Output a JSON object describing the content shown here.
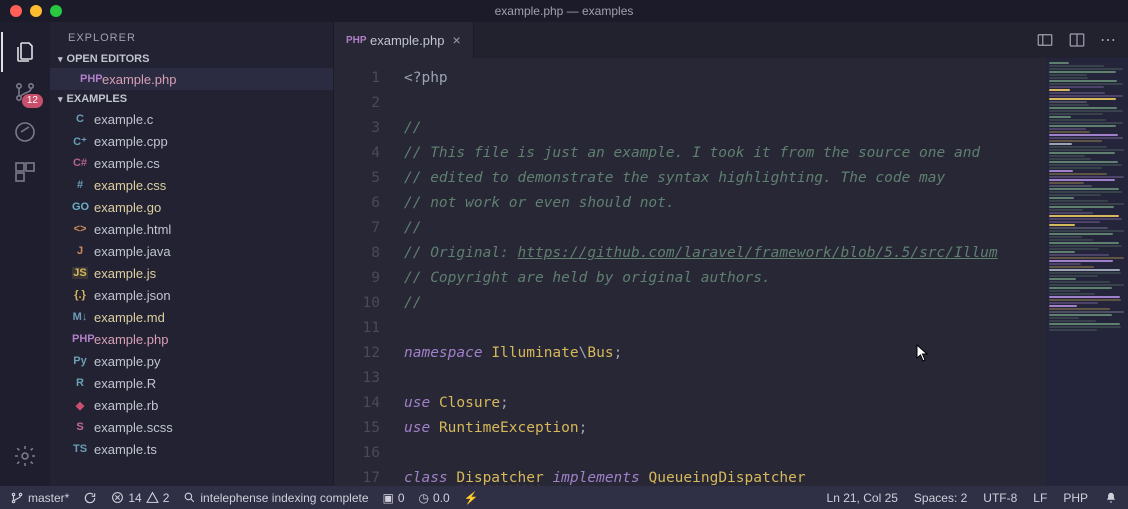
{
  "window": {
    "title": "example.php — examples"
  },
  "activity_bar": {
    "scm_badge": "12"
  },
  "sidebar": {
    "title": "EXPLORER",
    "sections": {
      "open_editors": "OPEN EDITORS",
      "folder": "EXAMPLES"
    },
    "open_editor_item": {
      "name": "example.php",
      "icon": "PHP"
    },
    "files": [
      {
        "name": "example.c",
        "icon": "C",
        "iconClass": "icon-c"
      },
      {
        "name": "example.cpp",
        "icon": "C⁺",
        "iconClass": "icon-cpp"
      },
      {
        "name": "example.cs",
        "icon": "C#",
        "iconClass": "icon-cs"
      },
      {
        "name": "example.css",
        "icon": "#",
        "iconClass": "icon-css",
        "accent": true
      },
      {
        "name": "example.go",
        "icon": "GO",
        "iconClass": "icon-go",
        "accent": true
      },
      {
        "name": "example.html",
        "icon": "<>",
        "iconClass": "icon-html"
      },
      {
        "name": "example.java",
        "icon": "J",
        "iconClass": "icon-java"
      },
      {
        "name": "example.js",
        "icon": "JS",
        "iconClass": "icon-js",
        "accent": true
      },
      {
        "name": "example.json",
        "icon": "{.}",
        "iconClass": "icon-json"
      },
      {
        "name": "example.md",
        "icon": "M↓",
        "iconClass": "icon-md",
        "accent": true
      },
      {
        "name": "example.php",
        "icon": "PHP",
        "iconClass": "icon-php",
        "accent": true,
        "selected": false,
        "phpAccent": true
      },
      {
        "name": "example.py",
        "icon": "Py",
        "iconClass": "icon-py"
      },
      {
        "name": "example.R",
        "icon": "R",
        "iconClass": "icon-r"
      },
      {
        "name": "example.rb",
        "icon": "◆",
        "iconClass": "icon-rb"
      },
      {
        "name": "example.scss",
        "icon": "S",
        "iconClass": "icon-scss"
      },
      {
        "name": "example.ts",
        "icon": "TS",
        "iconClass": "icon-ts"
      }
    ]
  },
  "editor": {
    "tab": {
      "name": "example.php",
      "icon": "PHP"
    },
    "lines": [
      {
        "n": 1,
        "html": "<span class='pun'>&lt;?php</span>"
      },
      {
        "n": 2,
        "html": ""
      },
      {
        "n": 3,
        "html": "<span class='cm'>//</span>"
      },
      {
        "n": 4,
        "html": "<span class='cm'>// This file is just an example. I took it from the source one and</span>"
      },
      {
        "n": 5,
        "html": "<span class='cm'>// edited to demonstrate the syntax highlighting. The code may</span>"
      },
      {
        "n": 6,
        "html": "<span class='cm'>// not work or even should not.</span>"
      },
      {
        "n": 7,
        "html": "<span class='cm'>//</span>"
      },
      {
        "n": 8,
        "html": "<span class='cm'>// Original: <span class='cm-link'>https://github.com/laravel/framework/blob/5.5/src/Illum</span></span>"
      },
      {
        "n": 9,
        "html": "<span class='cm'>// Copyright are held by original authors.</span>"
      },
      {
        "n": 10,
        "html": "<span class='cm'>//</span>"
      },
      {
        "n": 11,
        "html": ""
      },
      {
        "n": 12,
        "html": "<span class='kw'>namespace</span> <span class='ns'>Illuminate</span><span class='pun'>\\</span><span class='ns'>Bus</span><span class='pun'>;</span>"
      },
      {
        "n": 13,
        "html": ""
      },
      {
        "n": 14,
        "html": "<span class='kw'>use</span> <span class='cls'>Closure</span><span class='pun'>;</span>"
      },
      {
        "n": 15,
        "html": "<span class='kw'>use</span> <span class='cls'>RuntimeException</span><span class='pun'>;</span>"
      },
      {
        "n": 16,
        "html": ""
      },
      {
        "n": 17,
        "html": "<span class='kw'>class</span> <span class='cls squiggle'>Dispatcher</span> <span class='impl'>implements</span> <span class='cls'>QueueingDispatcher</span>"
      }
    ]
  },
  "status_bar": {
    "branch": "master*",
    "errors": "14",
    "warnings": "2",
    "indexing": "intelephense indexing complete",
    "cov": "0",
    "timing": "0.0",
    "cursor": "Ln 21, Col 25",
    "spaces": "Spaces: 2",
    "encoding": "UTF-8",
    "eol": "LF",
    "language": "PHP"
  }
}
